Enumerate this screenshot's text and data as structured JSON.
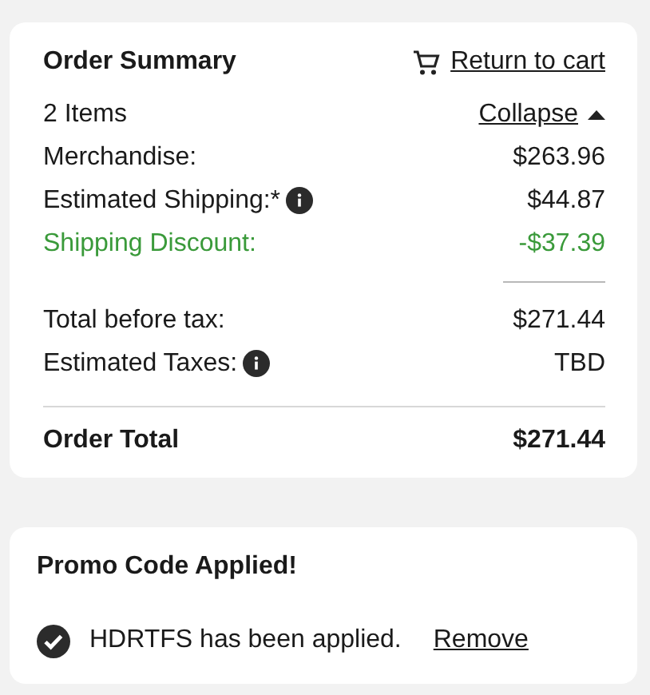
{
  "order_summary": {
    "title": "Order Summary",
    "return_link": "Return to cart",
    "items_count": "2 Items",
    "collapse_link": "Collapse",
    "expanded": true,
    "lines": [
      {
        "label": "Merchandise:",
        "value": "$263.96",
        "info": false,
        "kind": "normal"
      },
      {
        "label": "Estimated Shipping:*",
        "value": "$44.87",
        "info": true,
        "kind": "normal"
      },
      {
        "label": "Shipping Discount:",
        "value": "-$37.39",
        "info": false,
        "kind": "discount"
      }
    ],
    "subtotal_lines": [
      {
        "label": "Total before tax:",
        "value": "$271.44",
        "info": false
      },
      {
        "label": "Estimated Taxes:",
        "value": "TBD",
        "info": true
      }
    ],
    "total": {
      "label": "Order Total",
      "value": "$271.44"
    }
  },
  "promo": {
    "title": "Promo Code Applied!",
    "message": "HDRTFS has been applied.",
    "applied": true,
    "remove_link": "Remove"
  }
}
